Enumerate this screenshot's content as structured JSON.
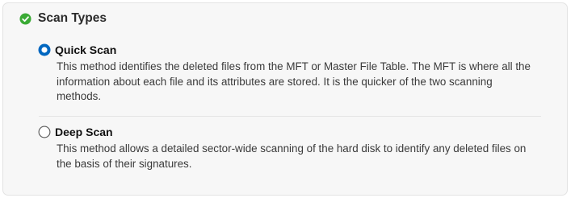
{
  "section": {
    "title": "Scan Types",
    "icon": "check-circle-icon",
    "icon_color": "#3aaa35"
  },
  "options": [
    {
      "label": "Quick Scan",
      "selected": true,
      "description": "This method identifies the deleted files from the MFT or Master File Table. The MFT is where all the information about each file and its attributes are stored. It is the quicker of the two scanning methods."
    },
    {
      "label": "Deep Scan",
      "selected": false,
      "description": "This method allows a detailed sector-wide scanning of the hard disk to identify any deleted files on the basis of their signatures."
    }
  ],
  "colors": {
    "accent": "#0067c0",
    "panel_bg": "#f7f7f7"
  }
}
